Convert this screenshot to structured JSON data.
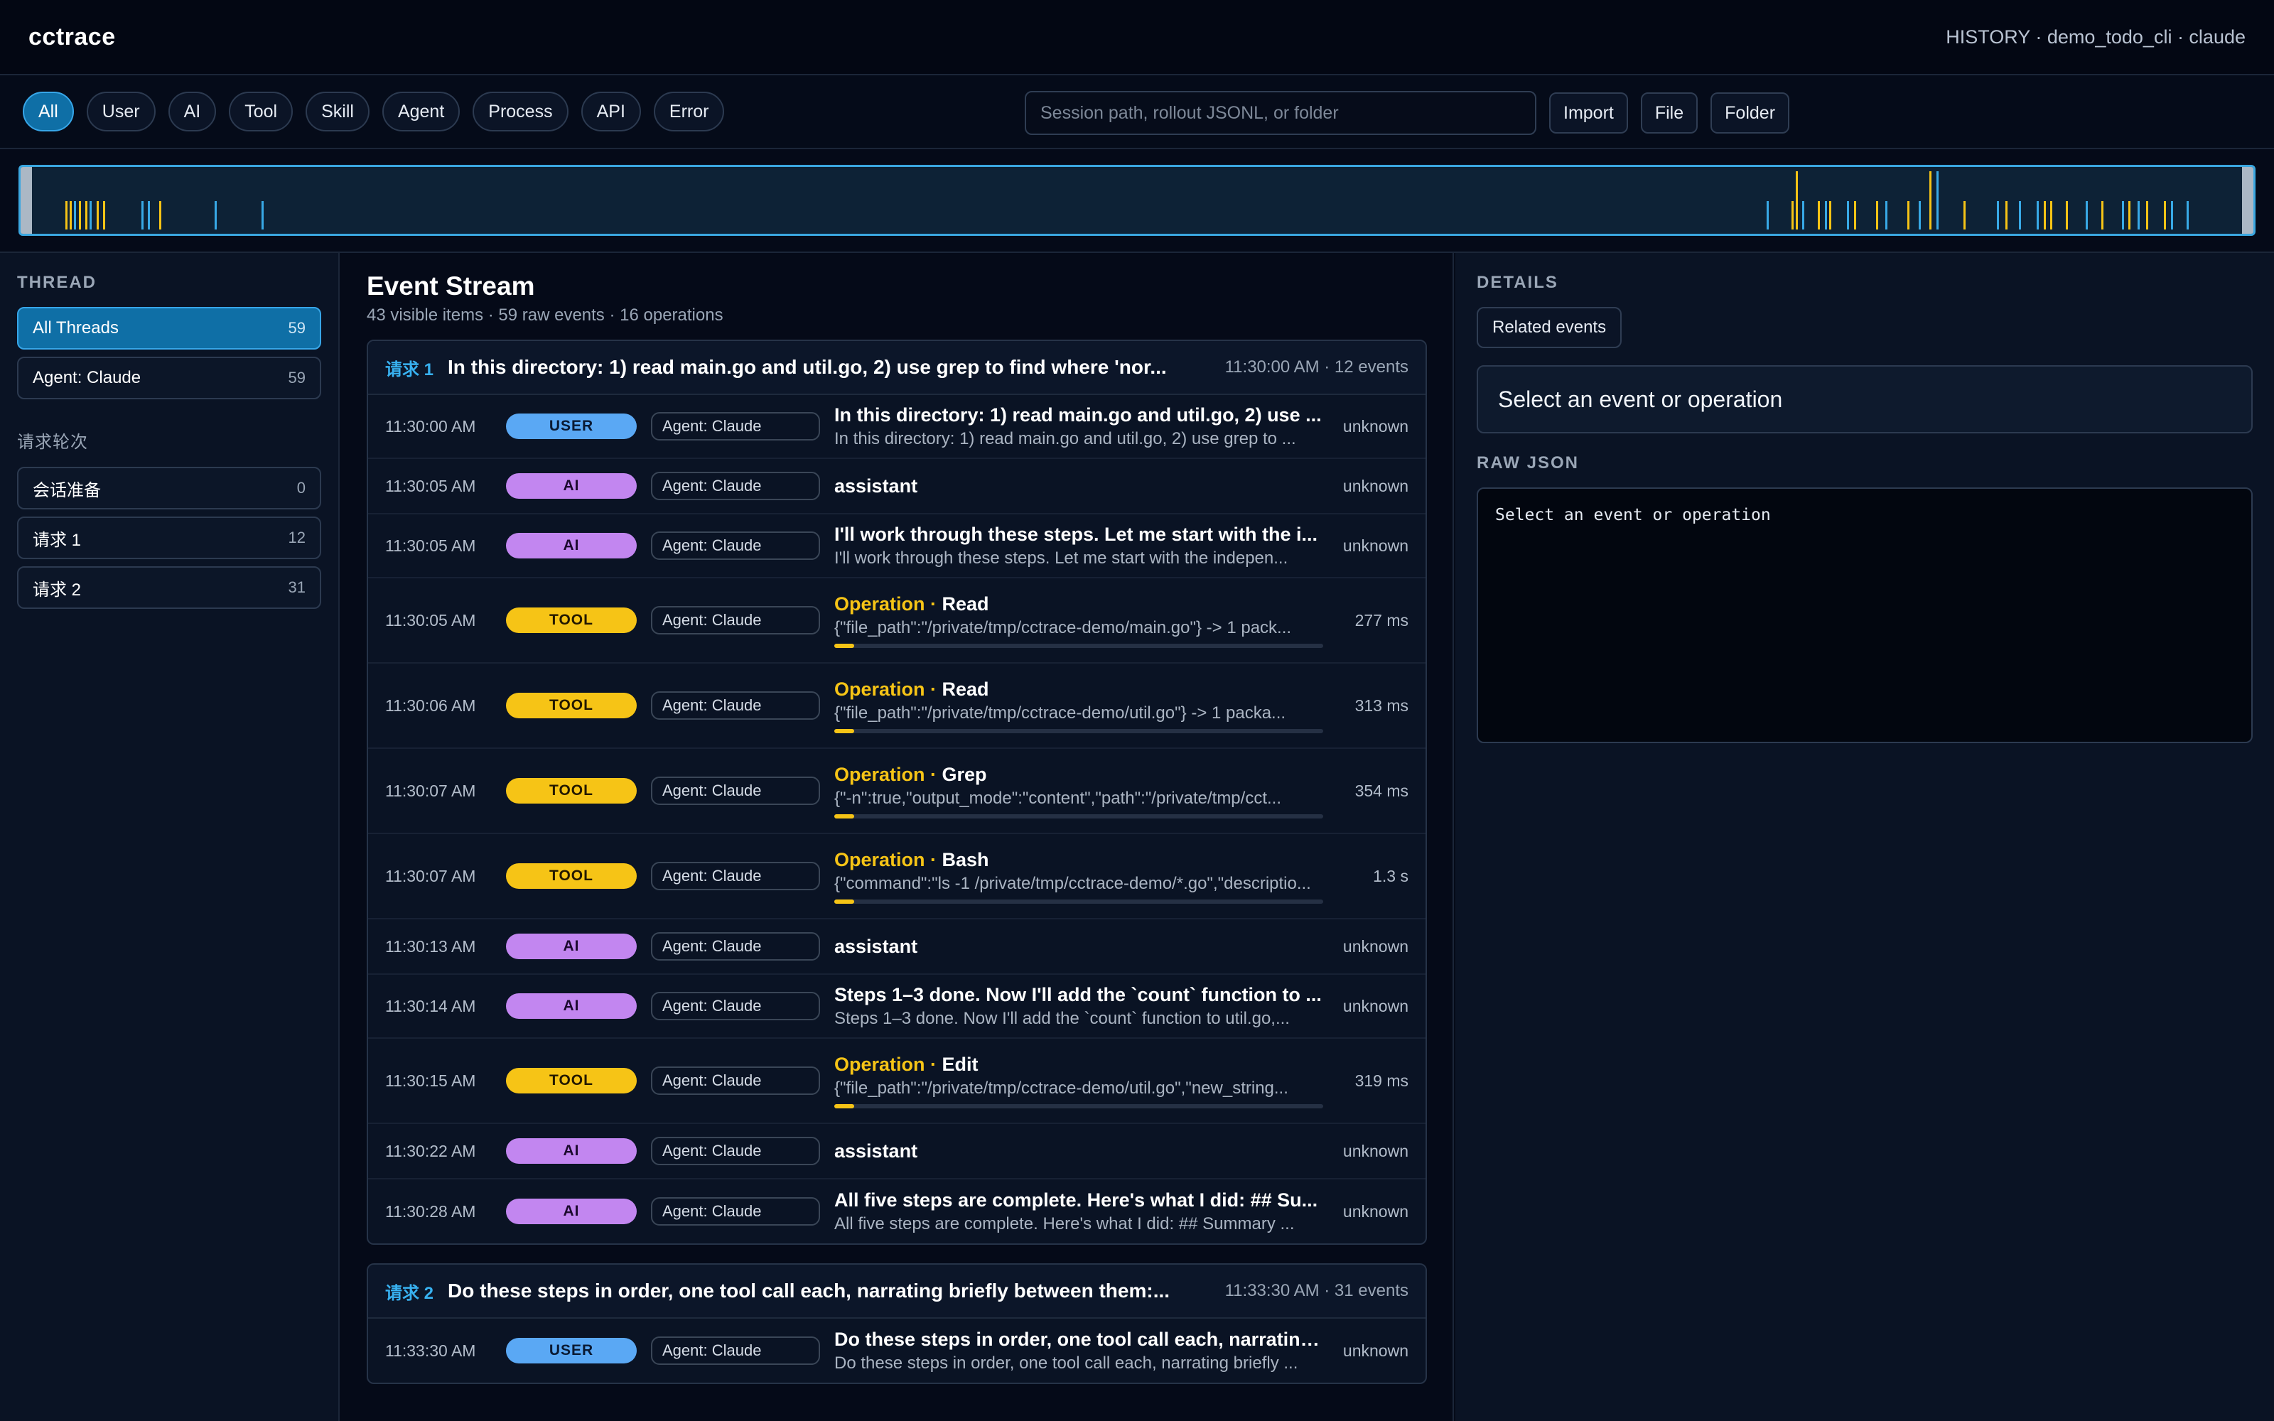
{
  "app": {
    "title": "cctrace",
    "session": "HISTORY · demo_todo_cli · claude"
  },
  "filters": [
    {
      "label": "All",
      "active": true
    },
    {
      "label": "User",
      "active": false
    },
    {
      "label": "AI",
      "active": false
    },
    {
      "label": "Tool",
      "active": false
    },
    {
      "label": "Skill",
      "active": false
    },
    {
      "label": "Agent",
      "active": false
    },
    {
      "label": "Process",
      "active": false
    },
    {
      "label": "API",
      "active": false
    },
    {
      "label": "Error",
      "active": false
    }
  ],
  "import": {
    "placeholder": "Session path, rollout JSONL, or folder",
    "import_label": "Import",
    "file_label": "File",
    "folder_label": "Folder"
  },
  "timeline": {
    "colors": {
      "tool": "#f6c416",
      "other": "#38a9e6"
    },
    "ticks": [
      {
        "t": 0.02,
        "kind": "tool",
        "tall": false
      },
      {
        "t": 0.022,
        "kind": "tool",
        "tall": false
      },
      {
        "t": 0.024,
        "kind": "other",
        "tall": false
      },
      {
        "t": 0.026,
        "kind": "tool",
        "tall": false
      },
      {
        "t": 0.029,
        "kind": "tool",
        "tall": false
      },
      {
        "t": 0.031,
        "kind": "other",
        "tall": false
      },
      {
        "t": 0.034,
        "kind": "tool",
        "tall": false
      },
      {
        "t": 0.037,
        "kind": "tool",
        "tall": false
      },
      {
        "t": 0.054,
        "kind": "other",
        "tall": false
      },
      {
        "t": 0.057,
        "kind": "other",
        "tall": false
      },
      {
        "t": 0.062,
        "kind": "tool",
        "tall": false
      },
      {
        "t": 0.087,
        "kind": "other",
        "tall": false
      },
      {
        "t": 0.108,
        "kind": "other",
        "tall": false
      },
      {
        "t": 0.782,
        "kind": "other",
        "tall": false
      },
      {
        "t": 0.793,
        "kind": "tool",
        "tall": false
      },
      {
        "t": 0.795,
        "kind": "tool",
        "tall": true
      },
      {
        "t": 0.798,
        "kind": "other",
        "tall": false
      },
      {
        "t": 0.805,
        "kind": "tool",
        "tall": false
      },
      {
        "t": 0.808,
        "kind": "other",
        "tall": false
      },
      {
        "t": 0.81,
        "kind": "tool",
        "tall": false
      },
      {
        "t": 0.818,
        "kind": "other",
        "tall": false
      },
      {
        "t": 0.821,
        "kind": "tool",
        "tall": false
      },
      {
        "t": 0.831,
        "kind": "tool",
        "tall": false
      },
      {
        "t": 0.835,
        "kind": "other",
        "tall": false
      },
      {
        "t": 0.845,
        "kind": "tool",
        "tall": false
      },
      {
        "t": 0.85,
        "kind": "other",
        "tall": false
      },
      {
        "t": 0.855,
        "kind": "tool",
        "tall": true
      },
      {
        "t": 0.858,
        "kind": "other",
        "tall": true
      },
      {
        "t": 0.87,
        "kind": "tool",
        "tall": false
      },
      {
        "t": 0.885,
        "kind": "other",
        "tall": false
      },
      {
        "t": 0.889,
        "kind": "tool",
        "tall": false
      },
      {
        "t": 0.895,
        "kind": "other",
        "tall": false
      },
      {
        "t": 0.903,
        "kind": "other",
        "tall": false
      },
      {
        "t": 0.906,
        "kind": "tool",
        "tall": false
      },
      {
        "t": 0.909,
        "kind": "tool",
        "tall": false
      },
      {
        "t": 0.916,
        "kind": "tool",
        "tall": false
      },
      {
        "t": 0.925,
        "kind": "other",
        "tall": false
      },
      {
        "t": 0.932,
        "kind": "tool",
        "tall": false
      },
      {
        "t": 0.941,
        "kind": "other",
        "tall": false
      },
      {
        "t": 0.944,
        "kind": "tool",
        "tall": false
      },
      {
        "t": 0.948,
        "kind": "other",
        "tall": false
      },
      {
        "t": 0.952,
        "kind": "tool",
        "tall": false
      },
      {
        "t": 0.96,
        "kind": "tool",
        "tall": false
      },
      {
        "t": 0.963,
        "kind": "other",
        "tall": false
      },
      {
        "t": 0.97,
        "kind": "other",
        "tall": false
      }
    ]
  },
  "sidebar": {
    "thread_heading": "THREAD",
    "threads": [
      {
        "label": "All Threads",
        "count": "59",
        "active": true
      },
      {
        "label": "Agent: Claude",
        "count": "59",
        "active": false
      }
    ],
    "rounds_heading": "请求轮次",
    "rounds": [
      {
        "label": "会话准备",
        "count": "0"
      },
      {
        "label": "请求 1",
        "count": "12"
      },
      {
        "label": "请求 2",
        "count": "31"
      }
    ]
  },
  "stream": {
    "title": "Event Stream",
    "stats": "43 visible items · 59 raw events · 16 operations",
    "groups": [
      {
        "tag": "请求 1",
        "title": "In this directory: 1) read main.go and util.go, 2) use grep to find where 'nor...",
        "meta": "11:30:00 AM · 12 events",
        "events": [
          {
            "time": "11:30:00 AM",
            "kind": "user",
            "badge": "USER",
            "agent": "Agent: Claude",
            "op": "",
            "title": "In this directory: 1) read main.go and util.go, 2) use ...",
            "sub": "In this directory: 1) read main.go and util.go, 2) use grep to ...",
            "dur": "unknown"
          },
          {
            "time": "11:30:05 AM",
            "kind": "ai",
            "badge": "AI",
            "agent": "Agent: Claude",
            "op": "",
            "title": "assistant",
            "sub": "",
            "dur": "unknown"
          },
          {
            "time": "11:30:05 AM",
            "kind": "ai",
            "badge": "AI",
            "agent": "Agent: Claude",
            "op": "",
            "title": "I'll work through these steps. Let me start with the i...",
            "sub": "I'll work through these steps. Let me start with the indepen...",
            "dur": "unknown"
          },
          {
            "time": "11:30:05 AM",
            "kind": "tool",
            "badge": "TOOL",
            "agent": "Agent: Claude",
            "op": "Operation",
            "title": "Read",
            "sub": "{\"file_path\":\"/private/tmp/cctrace-demo/main.go\"} -> 1 pack...",
            "dur": "277 ms",
            "progress": 0.04
          },
          {
            "time": "11:30:06 AM",
            "kind": "tool",
            "badge": "TOOL",
            "agent": "Agent: Claude",
            "op": "Operation",
            "title": "Read",
            "sub": "{\"file_path\":\"/private/tmp/cctrace-demo/util.go\"} -> 1 packa...",
            "dur": "313 ms",
            "progress": 0.04
          },
          {
            "time": "11:30:07 AM",
            "kind": "tool",
            "badge": "TOOL",
            "agent": "Agent: Claude",
            "op": "Operation",
            "title": "Grep",
            "sub": "{\"-n\":true,\"output_mode\":\"content\",\"path\":\"/private/tmp/cct...",
            "dur": "354 ms",
            "progress": 0.04
          },
          {
            "time": "11:30:07 AM",
            "kind": "tool",
            "badge": "TOOL",
            "agent": "Agent: Claude",
            "op": "Operation",
            "title": "Bash",
            "sub": "{\"command\":\"ls -1 /private/tmp/cctrace-demo/*.go\",\"descriptio...",
            "dur": "1.3 s",
            "progress": 0.04
          },
          {
            "time": "11:30:13 AM",
            "kind": "ai",
            "badge": "AI",
            "agent": "Agent: Claude",
            "op": "",
            "title": "assistant",
            "sub": "",
            "dur": "unknown"
          },
          {
            "time": "11:30:14 AM",
            "kind": "ai",
            "badge": "AI",
            "agent": "Agent: Claude",
            "op": "",
            "title": "Steps 1–3 done. Now I'll add the `count` function to ...",
            "sub": "Steps 1–3 done. Now I'll add the `count` function to util.go,...",
            "dur": "unknown"
          },
          {
            "time": "11:30:15 AM",
            "kind": "tool",
            "badge": "TOOL",
            "agent": "Agent: Claude",
            "op": "Operation",
            "title": "Edit",
            "sub": "{\"file_path\":\"/private/tmp/cctrace-demo/util.go\",\"new_string...",
            "dur": "319 ms",
            "progress": 0.04
          },
          {
            "time": "11:30:22 AM",
            "kind": "ai",
            "badge": "AI",
            "agent": "Agent: Claude",
            "op": "",
            "title": "assistant",
            "sub": "",
            "dur": "unknown"
          },
          {
            "time": "11:30:28 AM",
            "kind": "ai",
            "badge": "AI",
            "agent": "Agent: Claude",
            "op": "",
            "title": "All five steps are complete. Here's what I did: ## Su...",
            "sub": "All five steps are complete. Here's what I did: ## Summary ...",
            "dur": "unknown"
          }
        ]
      },
      {
        "tag": "请求 2",
        "title": "Do these steps in order, one tool call each, narrating briefly between them:...",
        "meta": "11:33:30 AM · 31 events",
        "events": [
          {
            "time": "11:33:30 AM",
            "kind": "user",
            "badge": "USER",
            "agent": "Agent: Claude",
            "op": "",
            "title": "Do these steps in order, one tool call each, narrating...",
            "sub": "Do these steps in order, one tool call each, narrating briefly ...",
            "dur": "unknown"
          }
        ]
      }
    ]
  },
  "details": {
    "heading": "DETAILS",
    "related_label": "Related events",
    "placeholder": "Select an event or operation",
    "raw_json_heading": "RAW JSON",
    "raw_json_placeholder": "Select an event or operation"
  }
}
